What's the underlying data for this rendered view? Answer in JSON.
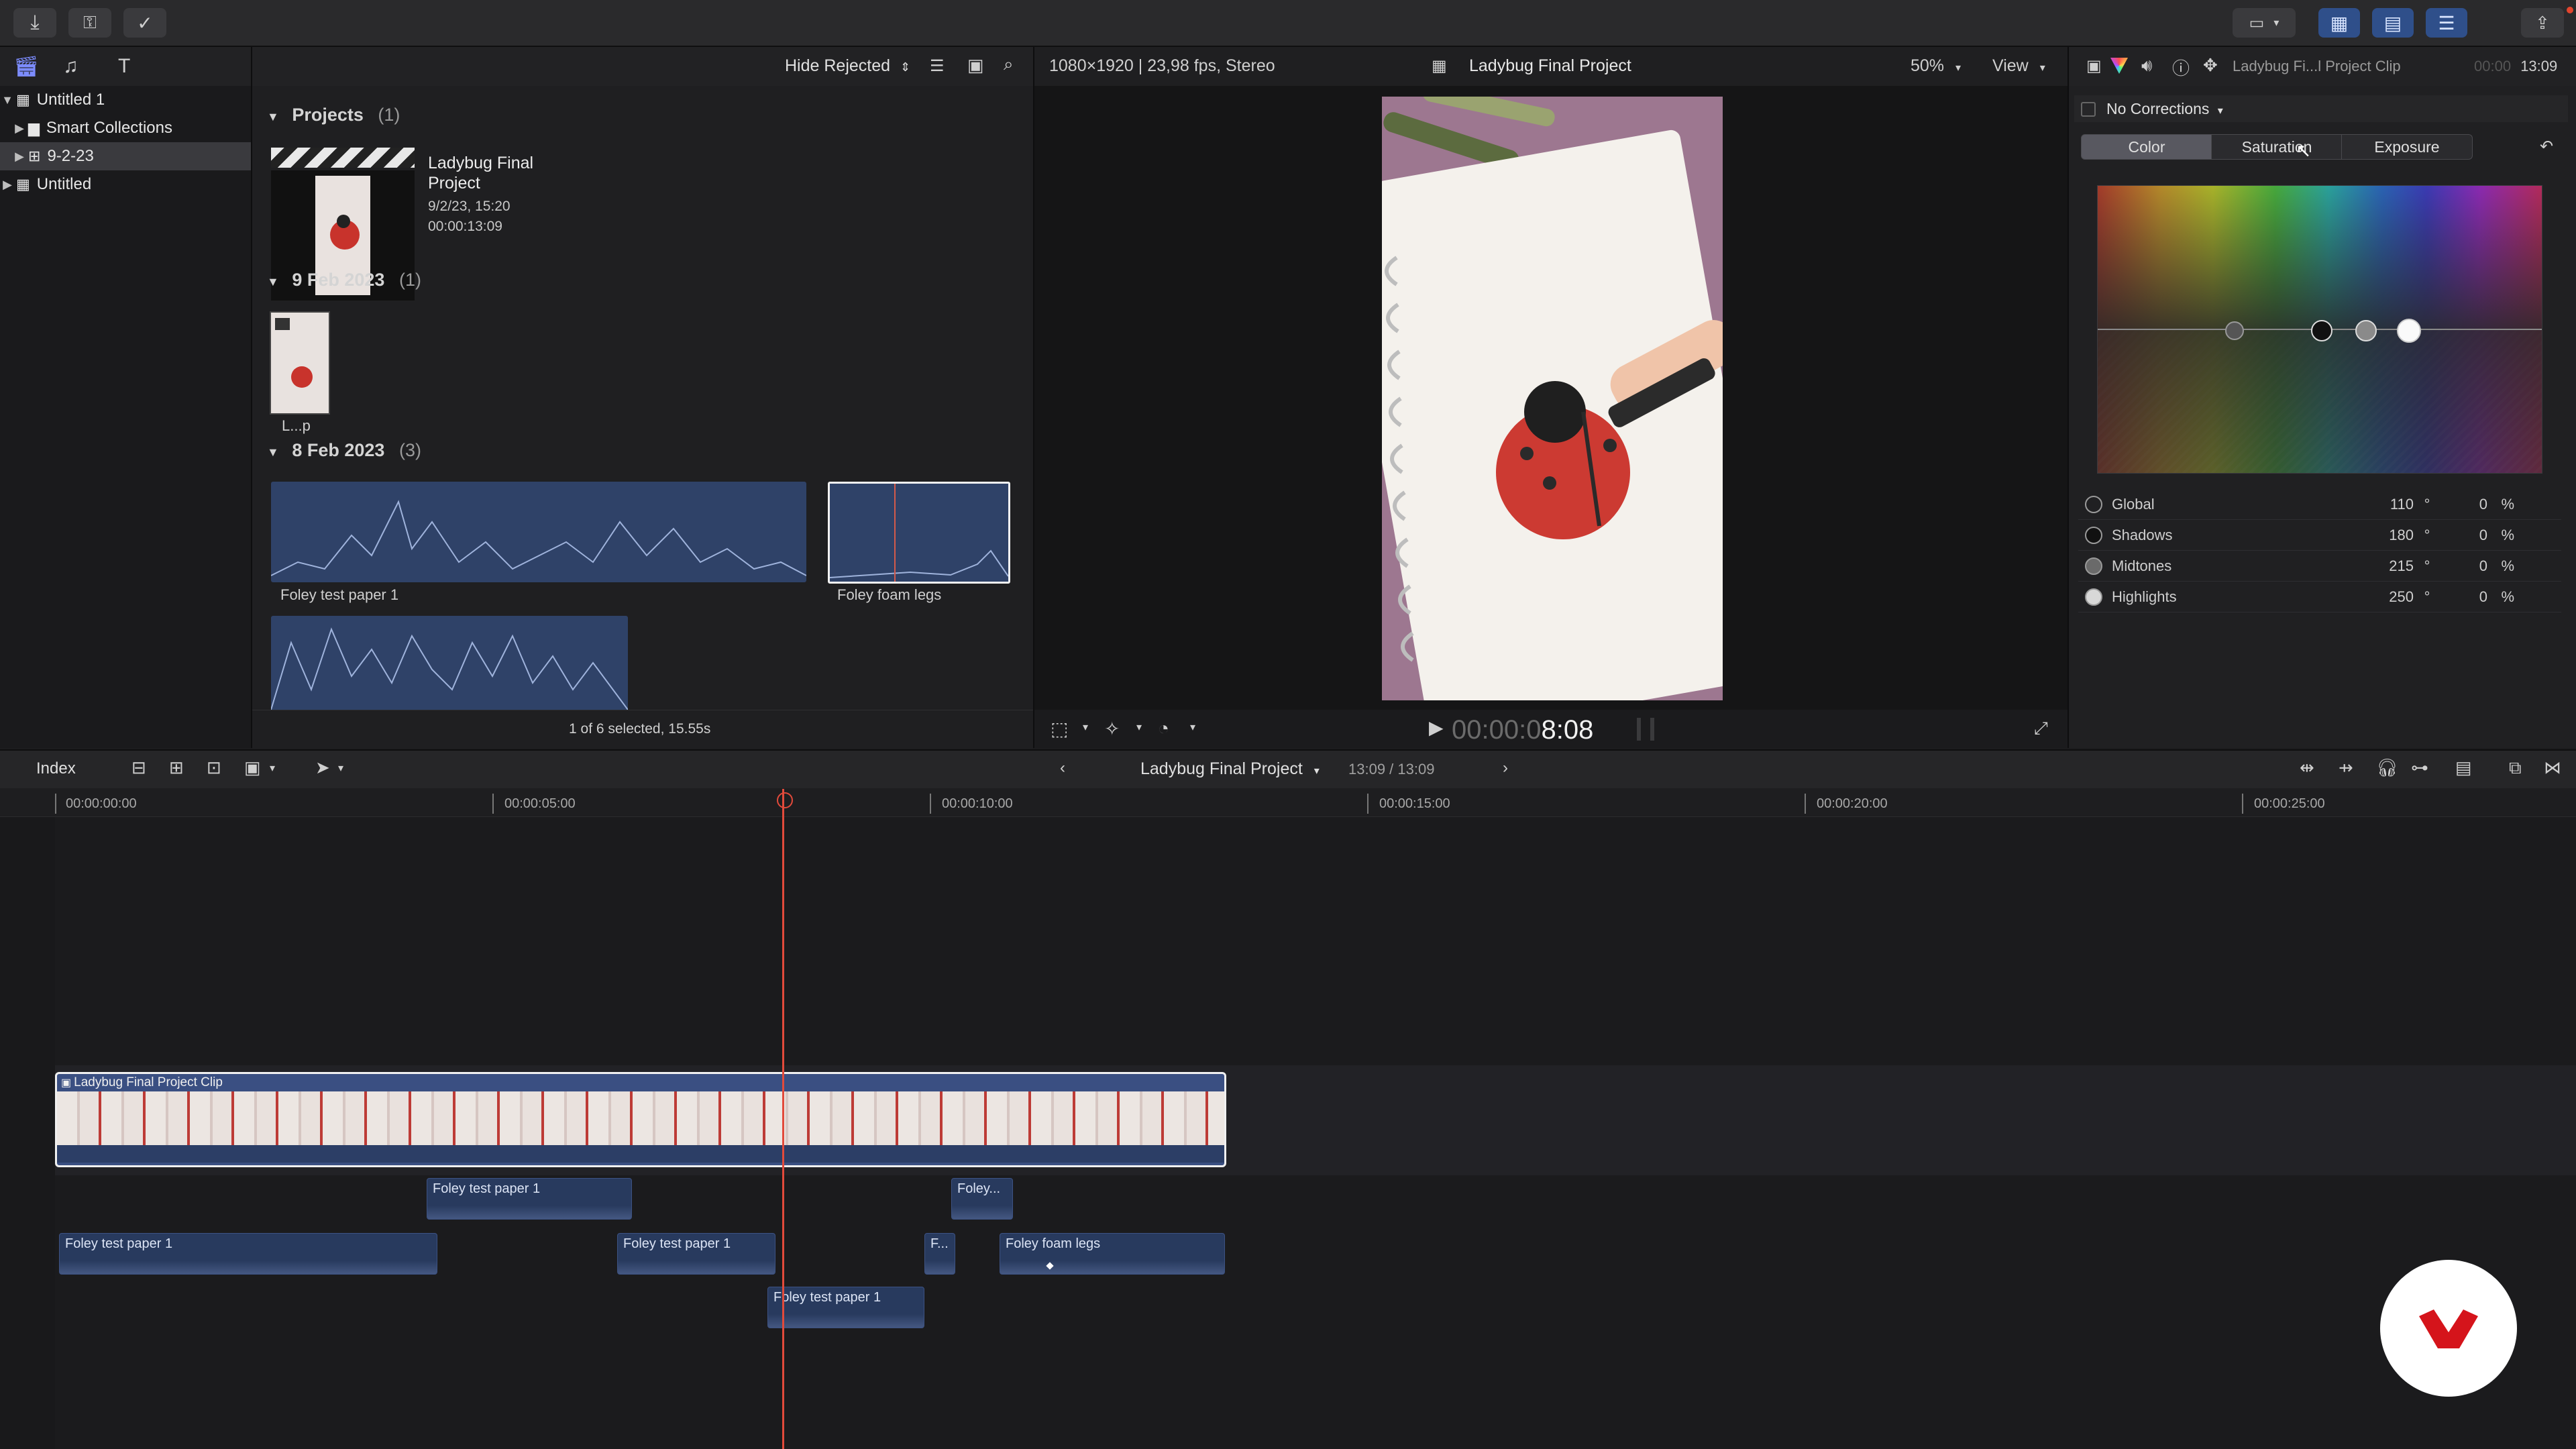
{
  "toolbar": {
    "import_icon": "download-arrow-icon",
    "keyword_icon": "key-icon",
    "background_tasks_icon": "check-circle-icon",
    "workspace_icon": "workspace-icon",
    "browser_icon": "browser-grid-icon",
    "timeline_icon": "timeline-icon",
    "inspector_icon": "inspector-sliders-icon",
    "share_icon": "share-icon"
  },
  "library": {
    "items": [
      {
        "label": "Untitled 1",
        "selected": false
      },
      {
        "label": "Smart Collections",
        "selected": false
      },
      {
        "label": "9-2-23",
        "selected": true
      },
      {
        "label": "Untitled",
        "selected": false
      }
    ]
  },
  "browser": {
    "filter": "Hide Rejected",
    "projects_header": "Projects",
    "projects_count": "(1)",
    "project_title": "Ladybug Final Project",
    "project_date": "9/2/23, 15:20",
    "project_duration": "00:00:13:09",
    "date1_header": "9 Feb 2023",
    "date1_count": "(1)",
    "date1_clip": "L...p",
    "date2_header": "8 Feb 2023",
    "date2_count": "(3)",
    "clip1": "Foley test paper 1",
    "clip2": "Foley foam legs",
    "selection_status": "1 of 6 selected, 15.55s"
  },
  "viewer": {
    "format": "1080×1920 | 23,98 fps, Stereo",
    "title": "Ladybug Final Project",
    "zoom": "50%",
    "view_menu": "View",
    "timecode_dim": "00:00:0",
    "timecode_bright": "8:08"
  },
  "inspector": {
    "clip_name": "Ladybug Fi...l Project Clip",
    "timecode_dim": "00:00",
    "timecode": "13:09",
    "corrections": "No Corrections",
    "tabs": [
      "Color",
      "Saturation",
      "Exposure"
    ],
    "active_tab": "Color",
    "rows": [
      {
        "label": "Global",
        "angle": "110",
        "degree": "°",
        "value": "0",
        "unit": "%"
      },
      {
        "label": "Shadows",
        "angle": "180",
        "degree": "°",
        "value": "0",
        "unit": "%"
      },
      {
        "label": "Midtones",
        "angle": "215",
        "degree": "°",
        "value": "0",
        "unit": "%"
      },
      {
        "label": "Highlights",
        "angle": "250",
        "degree": "°",
        "value": "0",
        "unit": "%"
      }
    ]
  },
  "timeline": {
    "index": "Index",
    "project": "Ladybug Final Project",
    "duration": "13:09 / 13:09",
    "ruler": [
      "00:00:00:00",
      "00:00:05:00",
      "00:00:10:00",
      "00:00:15:00",
      "00:00:20:00",
      "00:00:25:00"
    ],
    "primary_clip": "Ladybug Final Project Clip",
    "audio_clips": [
      "Foley test paper 1",
      "Foley...",
      "Foley test paper 1",
      "Foley test paper 1",
      "F...",
      "Foley foam legs",
      "Foley test paper 1"
    ]
  },
  "colors": {
    "accent": "#2f6fff",
    "playhead": "#e24a3b",
    "audio_clip": "#283a5e",
    "brand_red": "#d5141b"
  }
}
